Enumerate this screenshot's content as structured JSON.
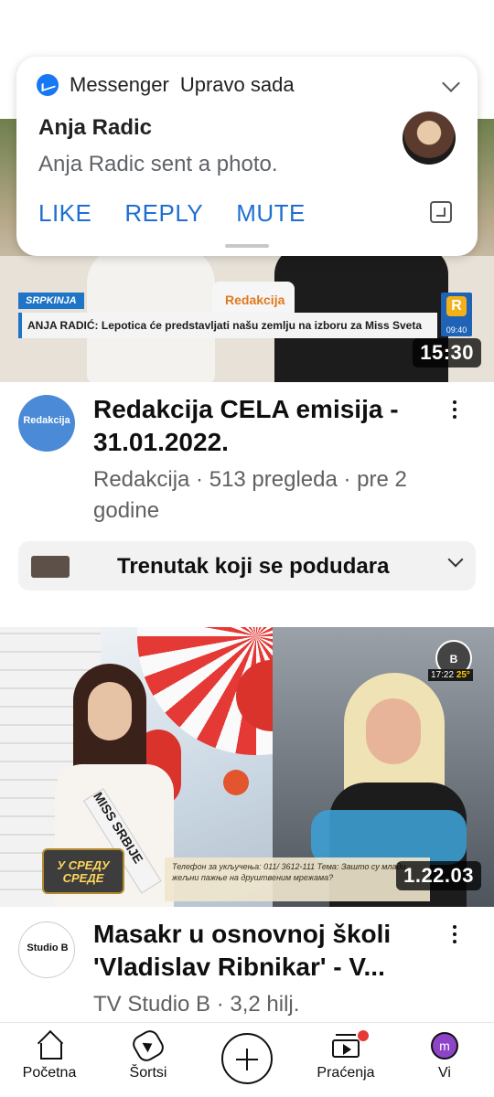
{
  "notification": {
    "app": "Messenger",
    "time": "Upravo sada",
    "sender": "Anja Radic",
    "message": "Anja Radic sent a photo.",
    "actions": [
      "LIKE",
      "REPLY",
      "MUTE"
    ]
  },
  "video1": {
    "overlay_tag": "SRPKINJA",
    "overlay_caption": "ANJA RADIĆ: Lepotica će predstavljati našu zemlju na izboru za Miss Sveta",
    "overlay_brand": "Redakcija",
    "overlay_clock": "09:40",
    "duration": "15:30",
    "channel_logo_text": "Redakcija",
    "title": "Redakcija CELA emisija - 31.01.2022.",
    "meta": "Redakcija · 513 pregleda · pre 2 godine"
  },
  "moment": {
    "label": "Trenutak koji se podudara"
  },
  "video2": {
    "overlay_clock": "17:22",
    "overlay_temp": "25°",
    "overlay_show": "У СРЕДУ СРЕДЕ",
    "overlay_sash": "MISS SRBIJE",
    "overlay_topic": "Телефон за укључења: 011/ 3612-111 Тема: Зашто су млади жељни пажње на друштвеним мрежама?",
    "duration": "1.22.03",
    "channel_logo_text": "Studio B",
    "title": "Masakr u osnovnoj školi 'Vladislav Ribnikar' - V...",
    "meta": "TV Studio B · 3,2 hilj."
  },
  "nav": {
    "home": "Početna",
    "shorts": "Šortsi",
    "subscriptions": "Praćenja",
    "you": "Vi",
    "you_avatar": "m"
  },
  "colors": {
    "accent_blue": "#1f6fd1",
    "notification_dot": "#e53935"
  }
}
